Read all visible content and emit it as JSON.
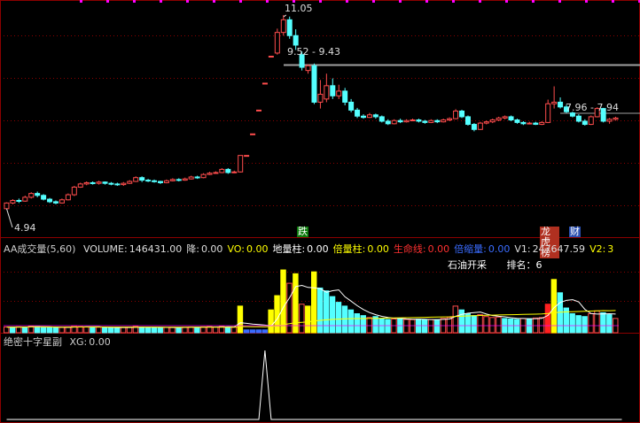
{
  "colors": {
    "bg": "#000000",
    "up": "#ff4d4d",
    "down": "#54ffff",
    "grid": "#8b0000",
    "gray": "#a0a0a0",
    "yellow": "#ffff00",
    "white": "#ffffff"
  },
  "chart_data": [
    {
      "type": "candlestick",
      "ylim": [
        4.6,
        11.3
      ],
      "annotations": {
        "high": "11.05",
        "low": "4.94",
        "level1": "9.52 - 9.43",
        "level2": "7.96 - 7.94"
      },
      "markers": {
        "die": "跌",
        "bang": "龙虎榜",
        "cai": "财"
      },
      "candles": [
        [
          4.94,
          5.12,
          5.14,
          4.94
        ],
        [
          5.12,
          5.2,
          5.24,
          5.08
        ],
        [
          5.2,
          5.18,
          5.26,
          5.12
        ],
        [
          5.18,
          5.3,
          5.35,
          5.16
        ],
        [
          5.3,
          5.42,
          5.46,
          5.26
        ],
        [
          5.42,
          5.36,
          5.48,
          5.3
        ],
        [
          5.36,
          5.24,
          5.4,
          5.2
        ],
        [
          5.24,
          5.16,
          5.28,
          5.12
        ],
        [
          5.16,
          5.12,
          5.2,
          5.08
        ],
        [
          5.12,
          5.22,
          5.26,
          5.1
        ],
        [
          5.22,
          5.38,
          5.42,
          5.2
        ],
        [
          5.38,
          5.62,
          5.66,
          5.34
        ],
        [
          5.62,
          5.72,
          5.76,
          5.6
        ],
        [
          5.72,
          5.76,
          5.8,
          5.68
        ],
        [
          5.76,
          5.74,
          5.8,
          5.7
        ],
        [
          5.74,
          5.78,
          5.82,
          5.7
        ],
        [
          5.78,
          5.74,
          5.8,
          5.7
        ],
        [
          5.74,
          5.72,
          5.78,
          5.68
        ],
        [
          5.72,
          5.7,
          5.76,
          5.66
        ],
        [
          5.7,
          5.74,
          5.78,
          5.66
        ],
        [
          5.74,
          5.8,
          5.84,
          5.72
        ],
        [
          5.8,
          5.92,
          5.96,
          5.78
        ],
        [
          5.92,
          5.84,
          5.96,
          5.78
        ],
        [
          5.84,
          5.82,
          5.88,
          5.78
        ],
        [
          5.82,
          5.8,
          5.86,
          5.76
        ],
        [
          5.8,
          5.76,
          5.82,
          5.72
        ],
        [
          5.76,
          5.82,
          5.86,
          5.74
        ],
        [
          5.82,
          5.86,
          5.9,
          5.8
        ],
        [
          5.86,
          5.84,
          5.9,
          5.8
        ],
        [
          5.84,
          5.88,
          5.92,
          5.82
        ],
        [
          5.88,
          5.94,
          5.98,
          5.86
        ],
        [
          5.94,
          5.92,
          5.98,
          5.88
        ],
        [
          5.92,
          6.02,
          6.06,
          5.9
        ],
        [
          6.02,
          6.06,
          6.1,
          6.0
        ],
        [
          6.06,
          6.08,
          6.12,
          6.04
        ],
        [
          6.08,
          6.18,
          6.22,
          6.06
        ],
        [
          6.18,
          6.08,
          6.22,
          6.04
        ],
        [
          6.08,
          6.1,
          6.14,
          6.06
        ],
        [
          6.1,
          6.62,
          6.62,
          6.08
        ],
        [
          6.62,
          6.62,
          6.62,
          6.62
        ],
        [
          7.3,
          7.3,
          7.3,
          7.3
        ],
        [
          8.05,
          8.05,
          8.05,
          8.05
        ],
        [
          8.9,
          8.9,
          8.9,
          8.9
        ],
        [
          9.75,
          9.75,
          9.75,
          9.75
        ],
        [
          9.85,
          10.5,
          10.62,
          9.8
        ],
        [
          10.5,
          10.9,
          11.05,
          10.4
        ],
        [
          10.9,
          10.4,
          11.0,
          10.3
        ],
        [
          10.4,
          10.1,
          10.6,
          9.95
        ],
        [
          9.8,
          9.4,
          9.9,
          9.3
        ],
        [
          9.3,
          9.45,
          9.5,
          9.2
        ],
        [
          9.45,
          8.3,
          9.52,
          8.24
        ],
        [
          8.3,
          8.55,
          9.0,
          8.1
        ],
        [
          8.4,
          8.82,
          9.2,
          8.3
        ],
        [
          8.82,
          8.5,
          9.05,
          8.4
        ],
        [
          8.5,
          8.65,
          8.85,
          8.4
        ],
        [
          8.65,
          8.3,
          8.75,
          8.2
        ],
        [
          8.3,
          8.05,
          8.4,
          7.98
        ],
        [
          8.05,
          7.86,
          8.12,
          7.8
        ],
        [
          7.86,
          7.82,
          7.92,
          7.78
        ],
        [
          7.82,
          7.9,
          7.96,
          7.8
        ],
        [
          7.9,
          7.84,
          7.94,
          7.78
        ],
        [
          7.84,
          7.7,
          7.88,
          7.66
        ],
        [
          7.7,
          7.62,
          7.76,
          7.58
        ],
        [
          7.62,
          7.72,
          7.76,
          7.6
        ],
        [
          7.72,
          7.68,
          7.78,
          7.64
        ],
        [
          7.68,
          7.72,
          7.76,
          7.66
        ],
        [
          7.72,
          7.74,
          7.78,
          7.7
        ],
        [
          7.74,
          7.7,
          7.78,
          7.66
        ],
        [
          7.7,
          7.66,
          7.74,
          7.62
        ],
        [
          7.66,
          7.72,
          7.76,
          7.64
        ],
        [
          7.72,
          7.68,
          7.76,
          7.64
        ],
        [
          7.68,
          7.74,
          7.78,
          7.66
        ],
        [
          7.74,
          7.78,
          7.82,
          7.7
        ],
        [
          7.78,
          8.02,
          8.08,
          7.76
        ],
        [
          8.02,
          7.84,
          8.06,
          7.8
        ],
        [
          7.84,
          7.6,
          7.88,
          7.56
        ],
        [
          7.6,
          7.44,
          7.64,
          7.38
        ],
        [
          7.44,
          7.64,
          7.68,
          7.42
        ],
        [
          7.64,
          7.68,
          7.72,
          7.6
        ],
        [
          7.68,
          7.74,
          7.78,
          7.64
        ],
        [
          7.74,
          7.8,
          7.84,
          7.7
        ],
        [
          7.8,
          7.84,
          7.88,
          7.76
        ],
        [
          7.84,
          7.74,
          7.88,
          7.7
        ],
        [
          7.74,
          7.66,
          7.78,
          7.62
        ],
        [
          7.66,
          7.62,
          7.7,
          7.58
        ],
        [
          7.62,
          7.64,
          7.68,
          7.6
        ],
        [
          7.64,
          7.6,
          7.68,
          7.58
        ],
        [
          7.6,
          7.66,
          7.7,
          7.58
        ],
        [
          7.66,
          8.25,
          8.38,
          7.64
        ],
        [
          8.25,
          8.3,
          8.8,
          8.1
        ],
        [
          8.3,
          8.15,
          8.45,
          8.1
        ],
        [
          8.15,
          8.0,
          8.22,
          7.96
        ],
        [
          7.96,
          7.86,
          8.0,
          7.82
        ],
        [
          7.86,
          7.7,
          7.92,
          7.66
        ],
        [
          7.7,
          7.6,
          7.76,
          7.56
        ],
        [
          7.6,
          7.84,
          7.88,
          7.58
        ],
        [
          7.84,
          8.1,
          8.14,
          7.82
        ],
        [
          8.1,
          7.7,
          8.12,
          7.66
        ],
        [
          7.7,
          7.76,
          7.8,
          7.62
        ],
        [
          7.76,
          7.8,
          7.84,
          7.72
        ]
      ]
    },
    {
      "type": "bar",
      "title": "AA成交量(5,60)",
      "legend": [
        {
          "label": "VOLUME:",
          "value": "146431.00",
          "color": "#dddddd"
        },
        {
          "label": "降:",
          "value": "0.00",
          "color": "#dddddd"
        },
        {
          "label": "VO:",
          "value": "0.00",
          "color": "#ffff00"
        },
        {
          "label": "地量柱:",
          "value": "0.00",
          "color": "#ffffff"
        },
        {
          "label": "倍量柱:",
          "value": "0.00",
          "color": "#ffff00"
        },
        {
          "label": "生命线:",
          "value": "0.00",
          "color": "#ff3030"
        },
        {
          "label": "倍缩量:",
          "value": "0.00",
          "color": "#3a6cff"
        },
        {
          "label": "V1:",
          "value": "247647.59",
          "color": "#dddddd"
        },
        {
          "label": "V2:",
          "value": "3",
          "color": "#ffff00"
        }
      ],
      "note": {
        "name": "石油开采",
        "rank_label": "排名：",
        "rank": "6"
      },
      "ylim": [
        0,
        800000
      ],
      "values": [
        60000,
        58000,
        62000,
        60000,
        70000,
        65000,
        55000,
        58000,
        52000,
        56000,
        60000,
        72000,
        64000,
        60000,
        56000,
        58000,
        56000,
        54000,
        52000,
        55000,
        58000,
        66000,
        60000,
        56000,
        54000,
        52000,
        56000,
        58000,
        55000,
        58000,
        60000,
        57000,
        62000,
        64000,
        60000,
        66000,
        60000,
        58000,
        280000,
        30000,
        30000,
        30000,
        30000,
        240000,
        390000,
        660000,
        520000,
        620000,
        300000,
        280000,
        640000,
        470000,
        440000,
        380000,
        320000,
        280000,
        240000,
        200000,
        180000,
        160000,
        170000,
        150000,
        140000,
        145000,
        150000,
        140000,
        138000,
        142000,
        135000,
        140000,
        136000,
        150000,
        160000,
        280000,
        240000,
        200000,
        180000,
        190000,
        170000,
        160000,
        165000,
        150000,
        145000,
        140000,
        150000,
        148000,
        155000,
        160000,
        300000,
        560000,
        420000,
        260000,
        200000,
        180000,
        170000,
        200000,
        230000,
        210000,
        190000,
        150000
      ],
      "bar_kind": [
        "up",
        "down",
        "up",
        "down",
        "up",
        "down",
        "down",
        "down",
        "down",
        "up",
        "up",
        "up",
        "up",
        "up",
        "down",
        "up",
        "down",
        "down",
        "down",
        "up",
        "up",
        "up",
        "down",
        "down",
        "down",
        "down",
        "up",
        "up",
        "down",
        "up",
        "up",
        "down",
        "up",
        "up",
        "up",
        "up",
        "down",
        "up",
        "yellow",
        "blue",
        "blue",
        "blue",
        "blue",
        "yellow",
        "yellow",
        "yellow",
        "up",
        "yellow",
        "up",
        "yellow",
        "yellow",
        "down",
        "down",
        "down",
        "down",
        "down",
        "down",
        "down",
        "down",
        "up",
        "down",
        "down",
        "down",
        "up",
        "down",
        "up",
        "up",
        "down",
        "down",
        "up",
        "down",
        "up",
        "up",
        "up",
        "down",
        "down",
        "down",
        "up",
        "up",
        "up",
        "up",
        "down",
        "down",
        "down",
        "up",
        "down",
        "up",
        "up",
        "red",
        "yellow",
        "down",
        "down",
        "down",
        "down",
        "down",
        "up",
        "up",
        "down",
        "down",
        "up"
      ]
    },
    {
      "type": "line",
      "title": "绝密十字星副",
      "legend": [
        {
          "label": "XG:",
          "value": "0.00",
          "color": "#dddddd"
        }
      ],
      "ylim": [
        0,
        1
      ],
      "values": [
        0,
        0,
        0,
        0,
        0,
        0,
        0,
        0,
        0,
        0,
        0,
        0,
        0,
        0,
        0,
        0,
        0,
        0,
        0,
        0,
        0,
        0,
        0,
        0,
        0,
        0,
        0,
        0,
        0,
        0,
        0,
        0,
        0,
        0,
        0,
        0,
        0,
        0,
        0,
        0,
        0,
        0,
        1,
        0,
        0,
        0,
        0,
        0,
        0,
        0,
        0,
        0,
        0,
        0,
        0,
        0,
        0,
        0,
        0,
        0,
        0,
        0,
        0,
        0,
        0,
        0,
        0,
        0,
        0,
        0,
        0,
        0,
        0,
        0,
        0,
        0,
        0,
        0,
        0,
        0,
        0,
        0,
        0,
        0,
        0,
        0,
        0,
        0,
        0,
        0,
        0,
        0,
        0,
        0,
        0,
        0,
        0,
        0,
        0,
        0,
        0
      ]
    }
  ]
}
